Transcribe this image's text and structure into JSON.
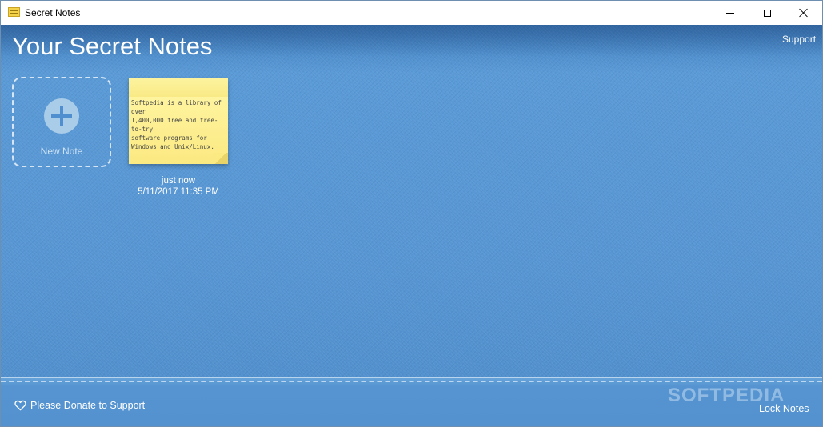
{
  "window": {
    "title": "Secret Notes"
  },
  "header": {
    "title": "Your Secret Notes",
    "support_label": "Support"
  },
  "new_note": {
    "label": "New Note",
    "icon": "plus-circle-icon"
  },
  "notes": [
    {
      "text": "Softpedia is a library of over\n1,400,000 free and free-to-try\nsoftware programs for\nWindows and Unix/Linux.",
      "relative_time": "just now",
      "date": "5/11/2017 11:35 PM"
    }
  ],
  "footer": {
    "donate_label": "Please Donate to Support",
    "lock_label": "Lock Notes",
    "watermark": "SOFTPEDIA"
  },
  "colors": {
    "background": "#5594d0",
    "note_yellow": "#fbe981",
    "text": "#ffffff"
  }
}
